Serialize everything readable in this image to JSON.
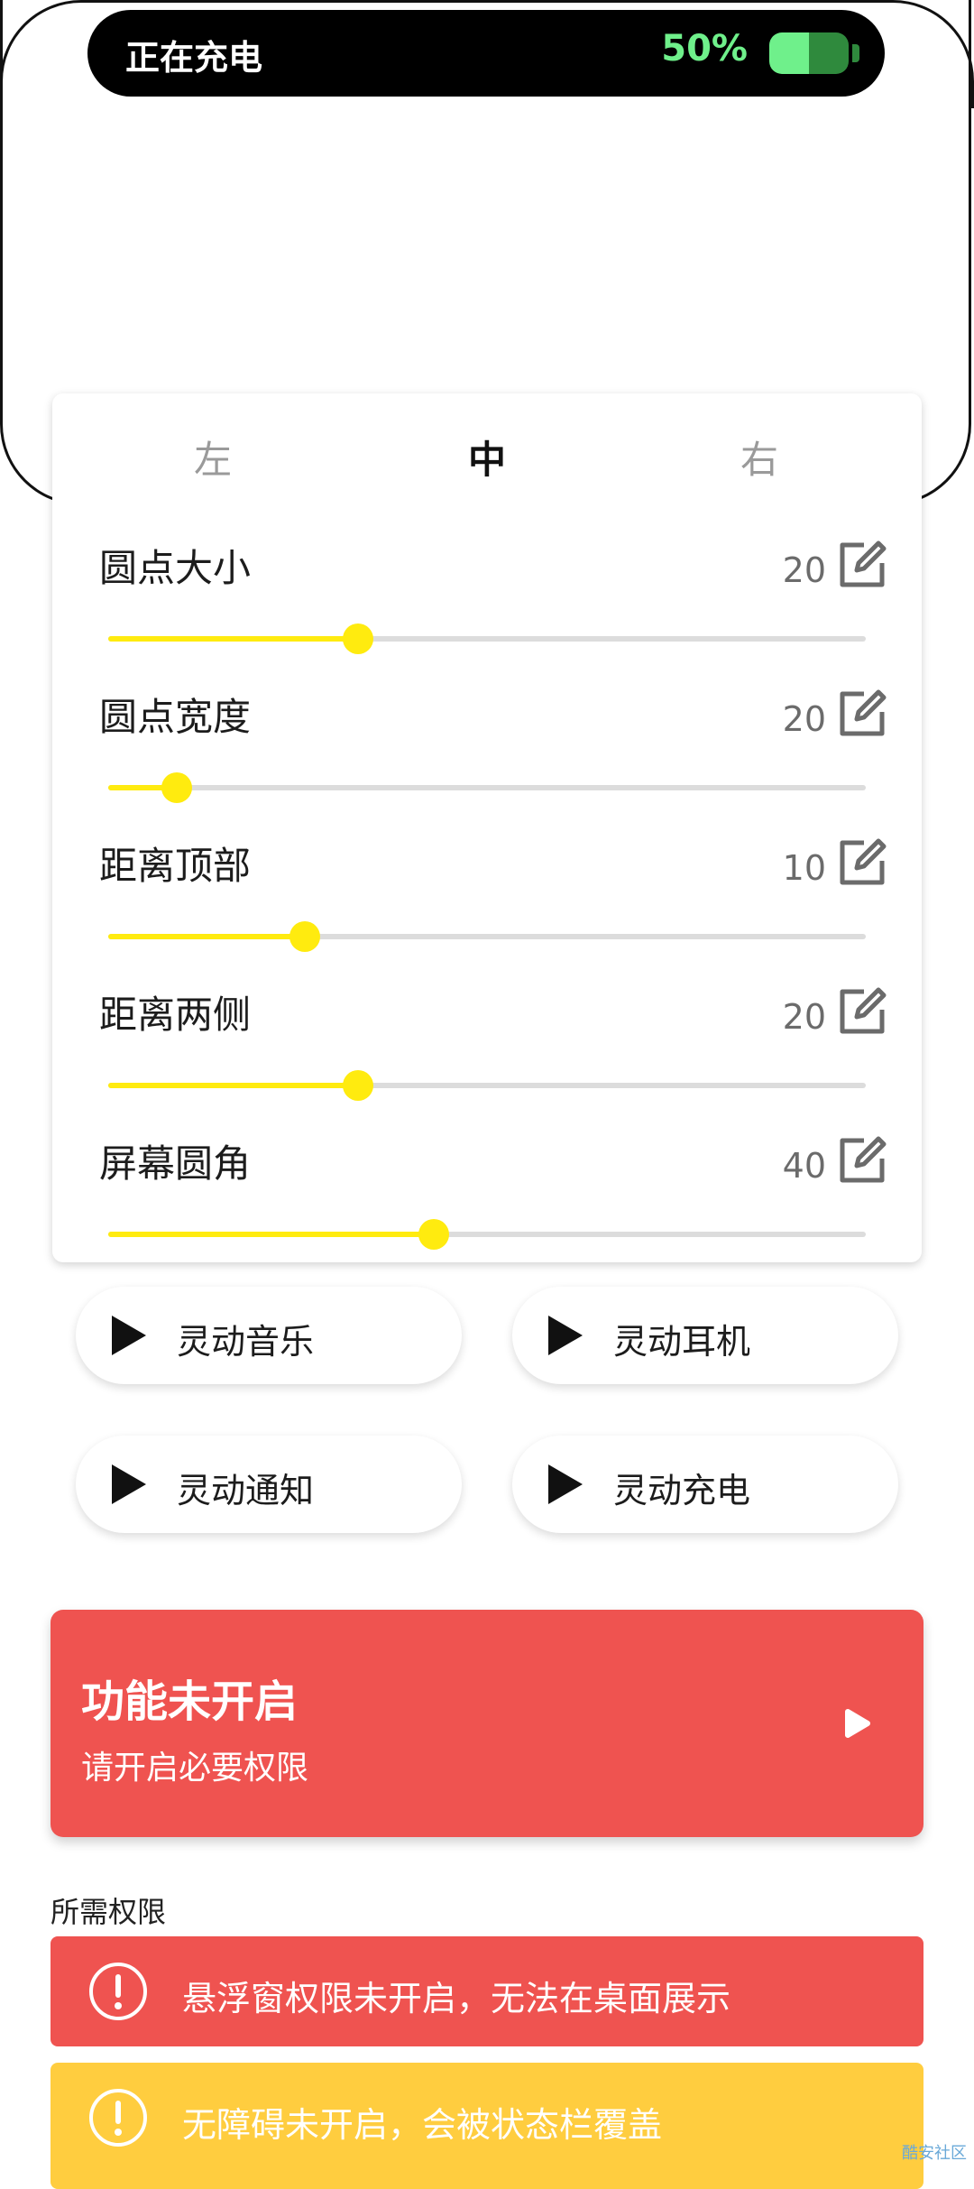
{
  "status_island": {
    "text": "正在充电",
    "battery_percent_label": "50%",
    "battery_level": 0.5,
    "accent_color": "#6ff08b"
  },
  "position_tabs": [
    {
      "label": "左",
      "active": false
    },
    {
      "label": "中",
      "active": true
    },
    {
      "label": "右",
      "active": false
    }
  ],
  "settings": [
    {
      "label": "圆点大小",
      "value": "20",
      "level": 0.33
    },
    {
      "label": "圆点宽度",
      "value": "20",
      "level": 0.09
    },
    {
      "label": "距离顶部",
      "value": "10",
      "level": 0.26
    },
    {
      "label": "距离两侧",
      "value": "20",
      "level": 0.33
    },
    {
      "label": "屏幕圆角",
      "value": "40",
      "level": 0.43
    }
  ],
  "features": [
    {
      "label": "灵动音乐"
    },
    {
      "label": "灵动耳机"
    },
    {
      "label": "灵动通知"
    },
    {
      "label": "灵动充电"
    }
  ],
  "alert": {
    "title": "功能未开启",
    "subtitle": "请开启必要权限",
    "color": "#ef5350"
  },
  "permissions": {
    "title": "所需权限",
    "items": [
      {
        "text": "悬浮窗权限未开启，无法在桌面展示",
        "color": "#ef5350"
      },
      {
        "text": "无障碍未开启，会被状态栏覆盖",
        "color": "#ffcd3f"
      }
    ]
  },
  "watermark": "酷安社区",
  "slider_color": "#ffeb0f"
}
